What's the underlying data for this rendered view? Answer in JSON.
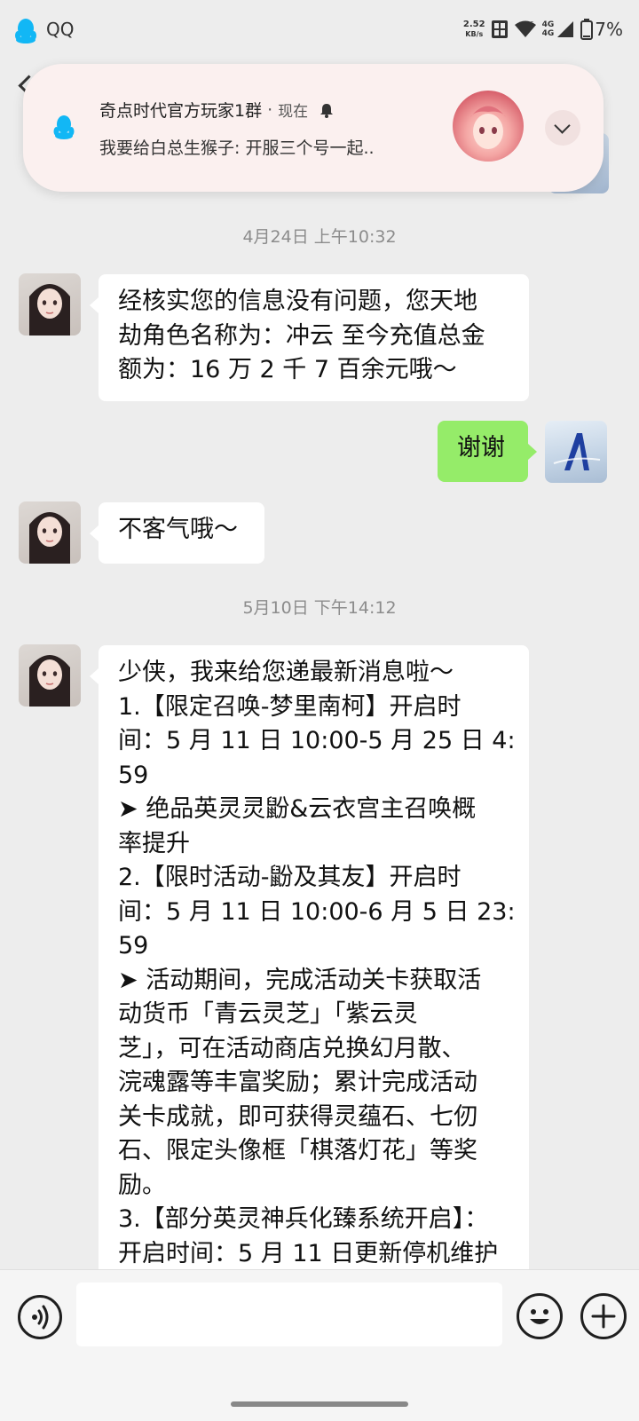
{
  "status_bar": {
    "app_name": "QQ",
    "net_speed": "2.52",
    "net_speed_unit": "KB/s",
    "net_type_1": "4G",
    "net_type_2": "4G",
    "battery": "7%"
  },
  "notification": {
    "title": "奇点时代官方玩家1群",
    "separator": "·",
    "time": "现在",
    "message": "我要给白总生猴子: 开服三个号一起.."
  },
  "chat": {
    "messages": [
      {
        "type": "timestamp",
        "text": "4月24日 上午10:32"
      },
      {
        "type": "incoming",
        "lines": [
          "经核实您的信息没有问题，您天地",
          "劫角色名称为：冲云 至今充值总金",
          "额为：16 万 2 千 7 百余元哦～"
        ]
      },
      {
        "type": "outgoing",
        "lines": [
          "谢谢"
        ]
      },
      {
        "type": "incoming",
        "lines": [
          "不客气哦～"
        ]
      },
      {
        "type": "timestamp",
        "text": "5月10日 下午14:12"
      },
      {
        "type": "incoming",
        "lines": [
          "少侠，我来给您递最新消息啦～",
          "1.【限定召唤-梦里南柯】开启时",
          "间：5 月 11 日 10:00-5 月 25 日 4:",
          "59",
          "➤ 绝品英灵灵鼢&云衣宫主召唤概",
          "率提升",
          "2.【限时活动-鼢及其友】开启时",
          "间：5 月 11 日 10:00-6 月 5 日 23:",
          "59",
          "➤ 活动期间，完成活动关卡获取活",
          "动货币「青云灵芝」「紫云灵",
          "芝」，可在活动商店兑换幻月散、",
          "浣魂露等丰富奖励；累计完成活动",
          "关卡成就，即可获得灵蕴石、七仞",
          "石、限定头像框「棋落灯花」等奖",
          "励。",
          "3.【部分英灵神兵化臻系统开启】：",
          "开启时间：5 月 11 日更新停机维护"
        ]
      }
    ]
  },
  "input_bar": {
    "placeholder": ""
  },
  "colors": {
    "background": "#ededed",
    "incoming_bubble": "#ffffff",
    "outgoing_bubble": "#95ec69",
    "notification_bg": "#fbf0ef",
    "qq_blue": "#12b7f5"
  }
}
